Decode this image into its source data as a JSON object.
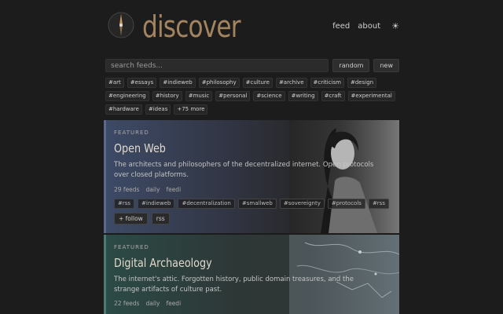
{
  "header": {
    "brand": "discover",
    "nav": {
      "feed": "feed",
      "about": "about",
      "theme_icon": "☀"
    },
    "logo_icon": "compass-icon"
  },
  "search": {
    "placeholder": "search feeds...",
    "random": "random",
    "new": "new"
  },
  "tags": [
    "#art",
    "#essays",
    "#indieweb",
    "#philosophy",
    "#culture",
    "#archive",
    "#criticism",
    "#design",
    "#engineering",
    "#history",
    "#music",
    "#personal",
    "#science",
    "#writing",
    "#craft",
    "#experimental",
    "#hardware",
    "#ideas",
    "+75 more"
  ],
  "cards": [
    {
      "label": "FEATURED",
      "title": "Open Web",
      "desc": "The architects and philosophers of the decentralized internet. Open protocols over closed platforms.",
      "count": "29 feeds",
      "freq": "daily",
      "source": "feedi",
      "tags": [
        "#rss",
        "#indieweb",
        "#decentralization",
        "#smallweb",
        "#sovereignty",
        "#protocols",
        "#rss"
      ],
      "follow": "+ follow",
      "rss": "rss",
      "accent": "#5b6a8a"
    },
    {
      "label": "FEATURED",
      "title": "Digital Archaeology",
      "desc": "The internet's attic. Forgotten history, public domain treasures, and the strange artifacts of culture past.",
      "count": "22 feeds",
      "freq": "daily",
      "source": "feedi",
      "accent": "#4b7a70"
    }
  ],
  "colors": {
    "background": "#1c1c1c",
    "brand": "#a4835f"
  }
}
